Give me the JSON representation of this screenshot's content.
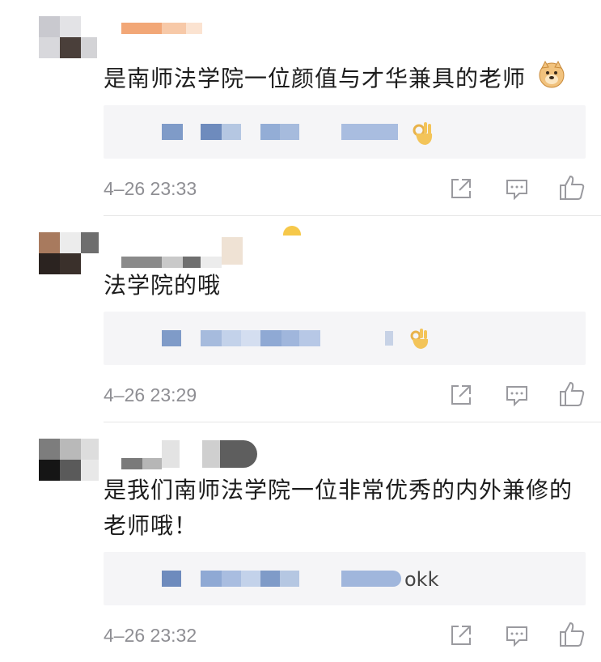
{
  "comments": [
    {
      "text": "是南师法学院一位颜值与才华兼具的老师",
      "emoji": "doge-emoji",
      "reply_emoji": "ok-hand-emoji",
      "reply_text": "",
      "time": "4–26 23:33"
    },
    {
      "text": "法学院的哦",
      "emoji": "",
      "reply_emoji": "ok-hand-emoji",
      "reply_text": "",
      "time": "4–26 23:29"
    },
    {
      "text": "是我们南师法学院一位非常优秀的内外兼修的老师哦！",
      "emoji": "",
      "reply_emoji": "",
      "reply_text": "okk",
      "time": "4–26 23:32"
    }
  ],
  "icons": {
    "share": "share-icon",
    "comment": "comment-icon",
    "like": "like-icon"
  },
  "colors": {
    "reply_bg": "#f5f5f7",
    "time": "#8e8e93",
    "icon": "#9a9a9f",
    "blur_blue": "#7f9bc8"
  }
}
